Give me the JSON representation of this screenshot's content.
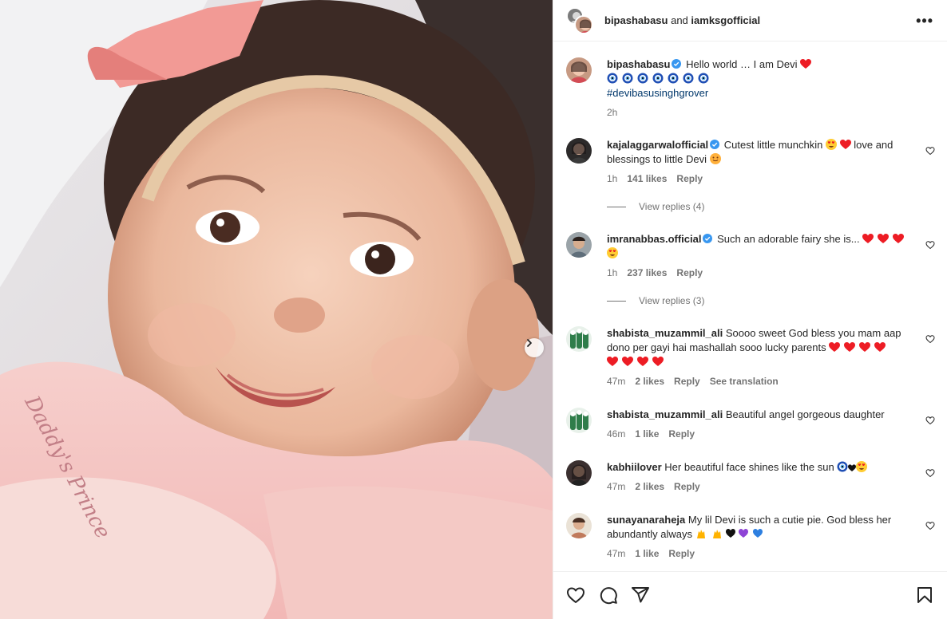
{
  "header": {
    "user1": "bipashabasu",
    "and_text": "and",
    "user2": "iamksgofficial",
    "more_label": "•••"
  },
  "caption": {
    "username": "bipashabasu",
    "text": "Hello world … I am Devi",
    "hashtag": "#devibasusinghgrover",
    "time": "2h"
  },
  "comments": [
    {
      "username": "kajalaggarwalofficial",
      "text_a": "Cutest little munchkin",
      "text_b": "love and blessings to little Devi",
      "time": "1h",
      "likes": "141 likes",
      "reply": "Reply",
      "view_replies": "View replies (4)"
    },
    {
      "username": "imranabbas.official",
      "text_a": "Such an adorable fairy she is...",
      "time": "1h",
      "likes": "237 likes",
      "reply": "Reply",
      "view_replies": "View replies (3)"
    },
    {
      "username": "shabista_muzammil_ali",
      "text_a": "Soooo sweet God bless you mam aap dono per gayi hai mashallah sooo lucky parents",
      "time": "47m",
      "likes": "2 likes",
      "reply": "Reply",
      "translate": "See translation"
    },
    {
      "username": "shabista_muzammil_ali",
      "text_a": "Beautiful angel gorgeous daughter",
      "time": "46m",
      "likes": "1 like",
      "reply": "Reply"
    },
    {
      "username": "kabhiilover",
      "text_a": "Her beautiful face shines like the sun",
      "time": "47m",
      "likes": "2 likes",
      "reply": "Reply"
    },
    {
      "username": "sunayanaraheja",
      "text_a": "My lil Devi is such a cutie pie. God bless her abundantly always",
      "time": "47m",
      "likes": "1 like",
      "reply": "Reply"
    }
  ],
  "icons": {
    "like": "heart-icon",
    "comment": "comment-icon",
    "share": "send-icon",
    "save": "bookmark-icon",
    "next": "chevron-right-icon",
    "verified": "verified-badge-icon"
  },
  "colors": {
    "verified": "#3897f0",
    "heart_red": "#ed1c24",
    "hashtag": "#00376b",
    "muted": "#737373",
    "nazar_blue": "#1f4fb5"
  }
}
